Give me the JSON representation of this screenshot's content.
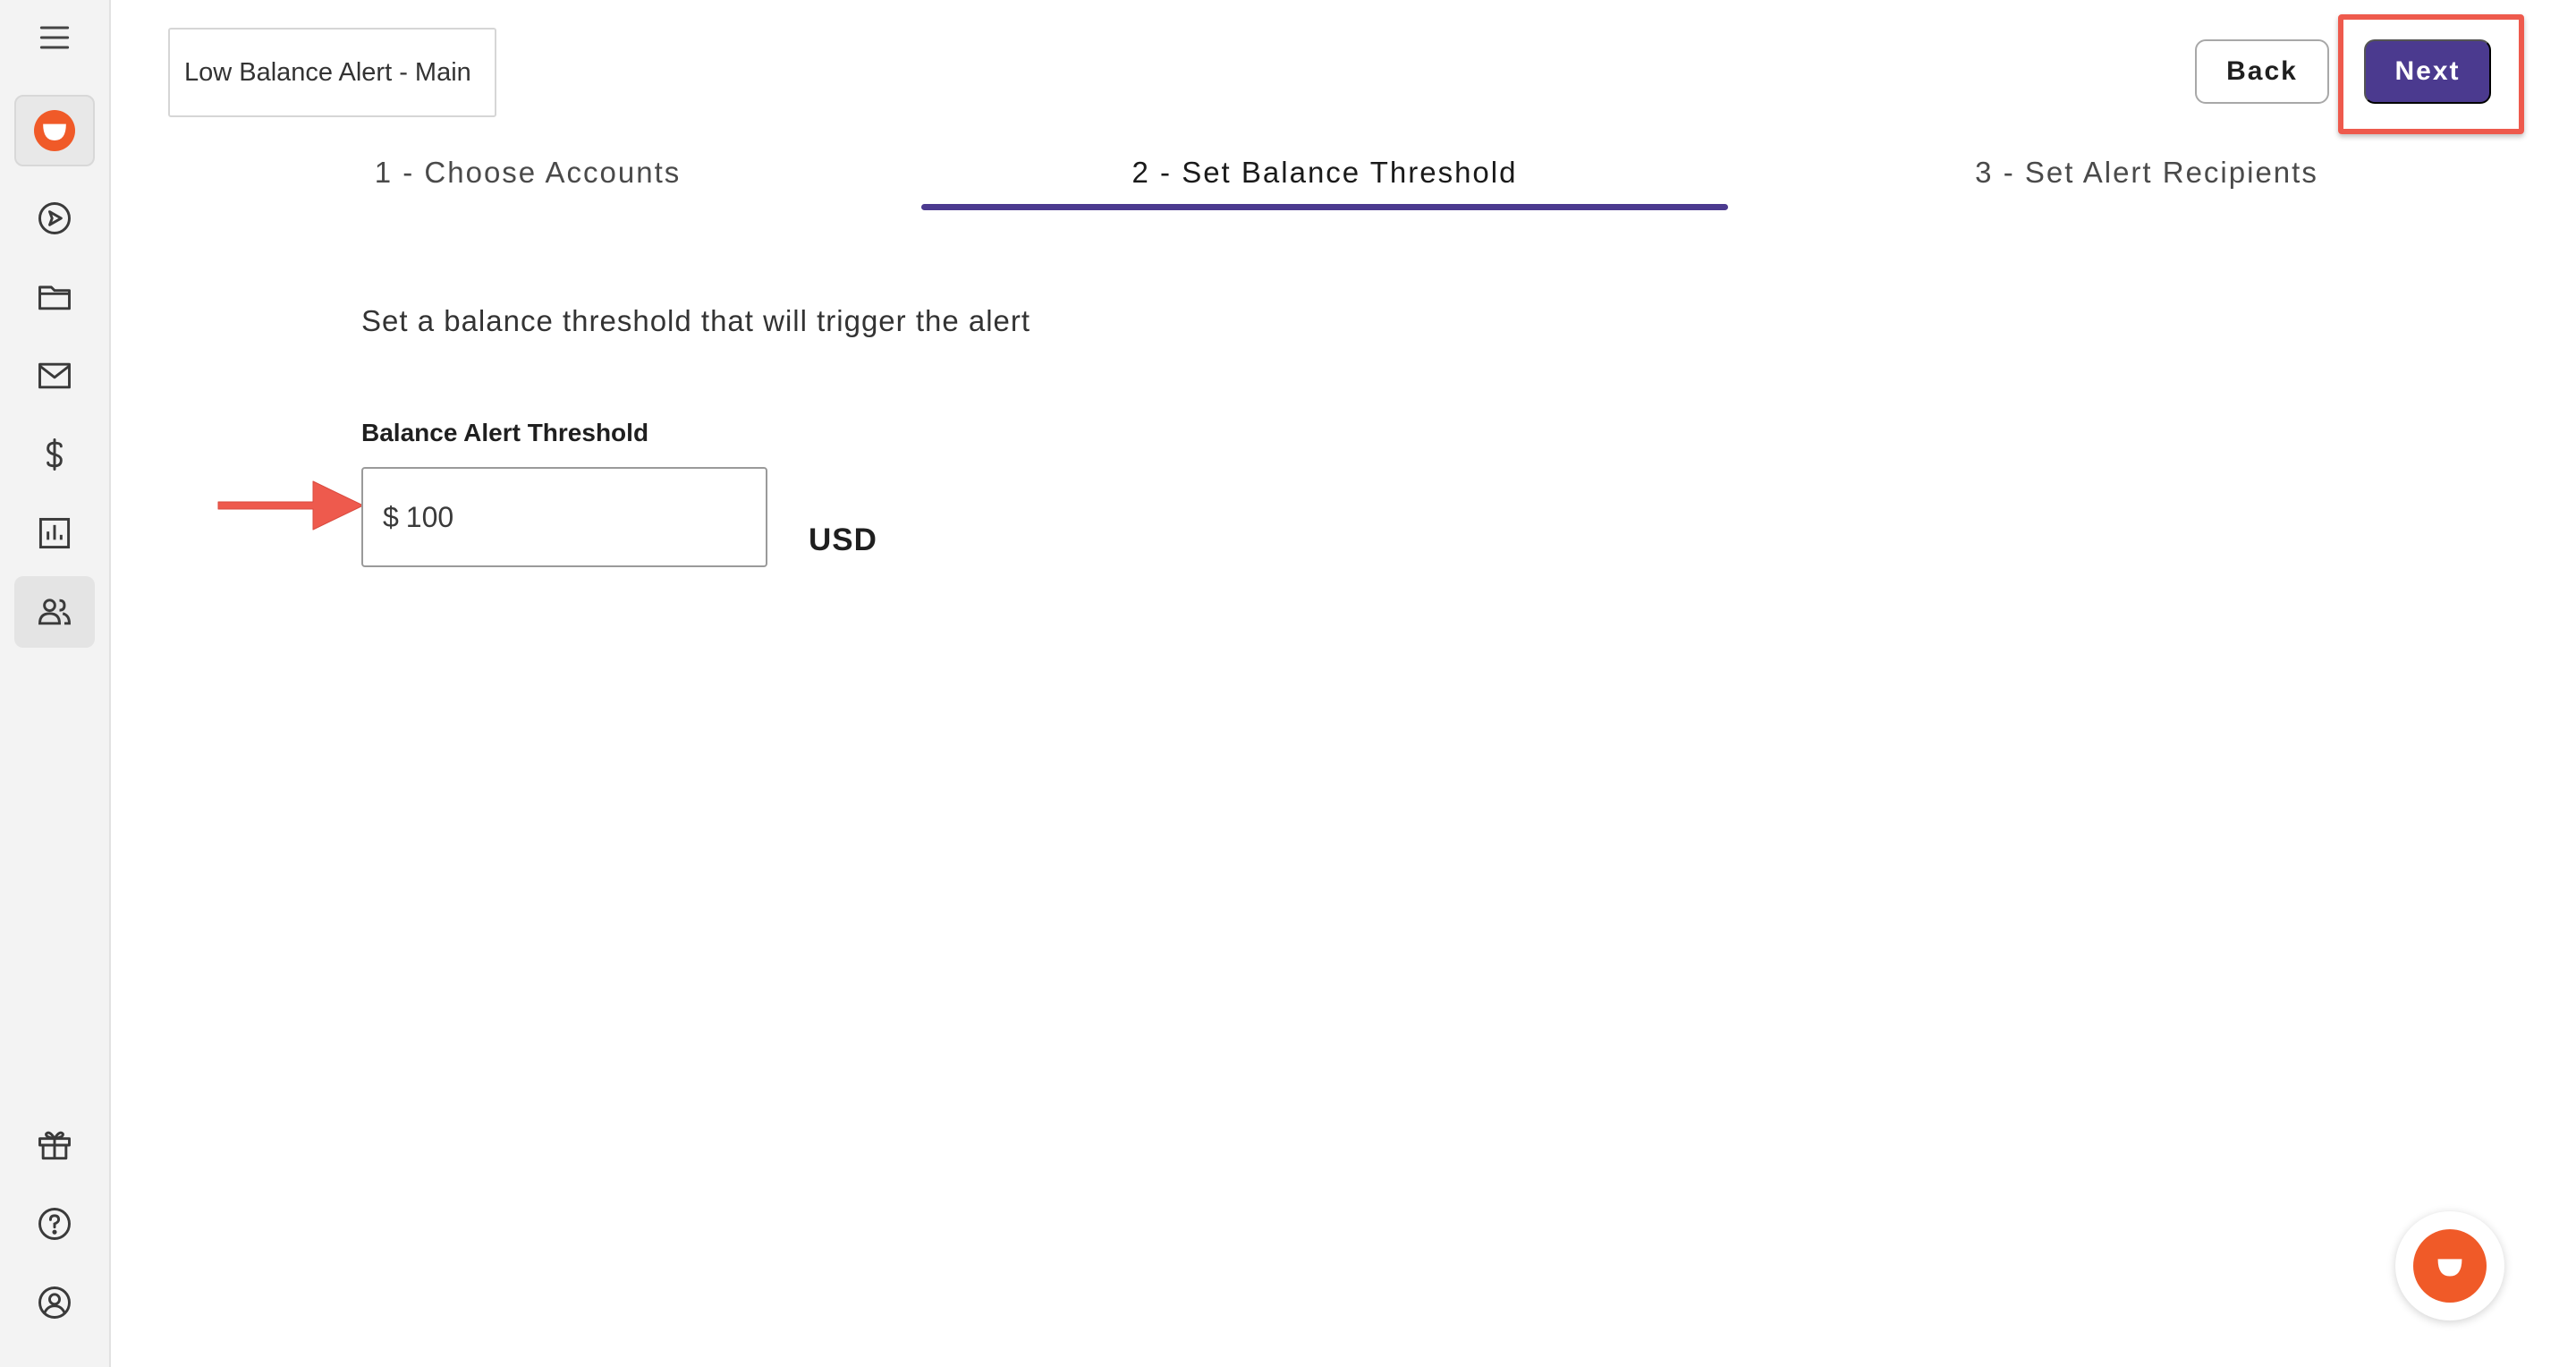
{
  "sidebar": {
    "items": [
      {
        "icon": "menu-icon"
      },
      {
        "icon": "brand-logo-icon"
      },
      {
        "icon": "send-icon"
      },
      {
        "icon": "folder-icon"
      },
      {
        "icon": "mail-icon"
      },
      {
        "icon": "dollar-icon"
      },
      {
        "icon": "bar-chart-icon"
      },
      {
        "icon": "people-icon"
      },
      {
        "icon": "gift-icon"
      },
      {
        "icon": "help-icon"
      },
      {
        "icon": "account-icon"
      }
    ]
  },
  "header": {
    "alert_name": "Low Balance Alert - Main",
    "back_label": "Back",
    "next_label": "Next"
  },
  "steps": [
    {
      "label": "1 - Choose Accounts",
      "active": false
    },
    {
      "label": "2 - Set Balance Threshold",
      "active": true
    },
    {
      "label": "3 - Set Alert Recipients",
      "active": false
    }
  ],
  "form": {
    "instruction": "Set a balance threshold that will trigger the alert",
    "threshold_label": "Balance Alert Threshold",
    "currency_symbol": "$",
    "threshold_value": "100",
    "currency_code": "USD"
  },
  "colors": {
    "accent": "#4b3a8f",
    "brand": "#f05a28",
    "annotation": "#ee5a4d"
  }
}
